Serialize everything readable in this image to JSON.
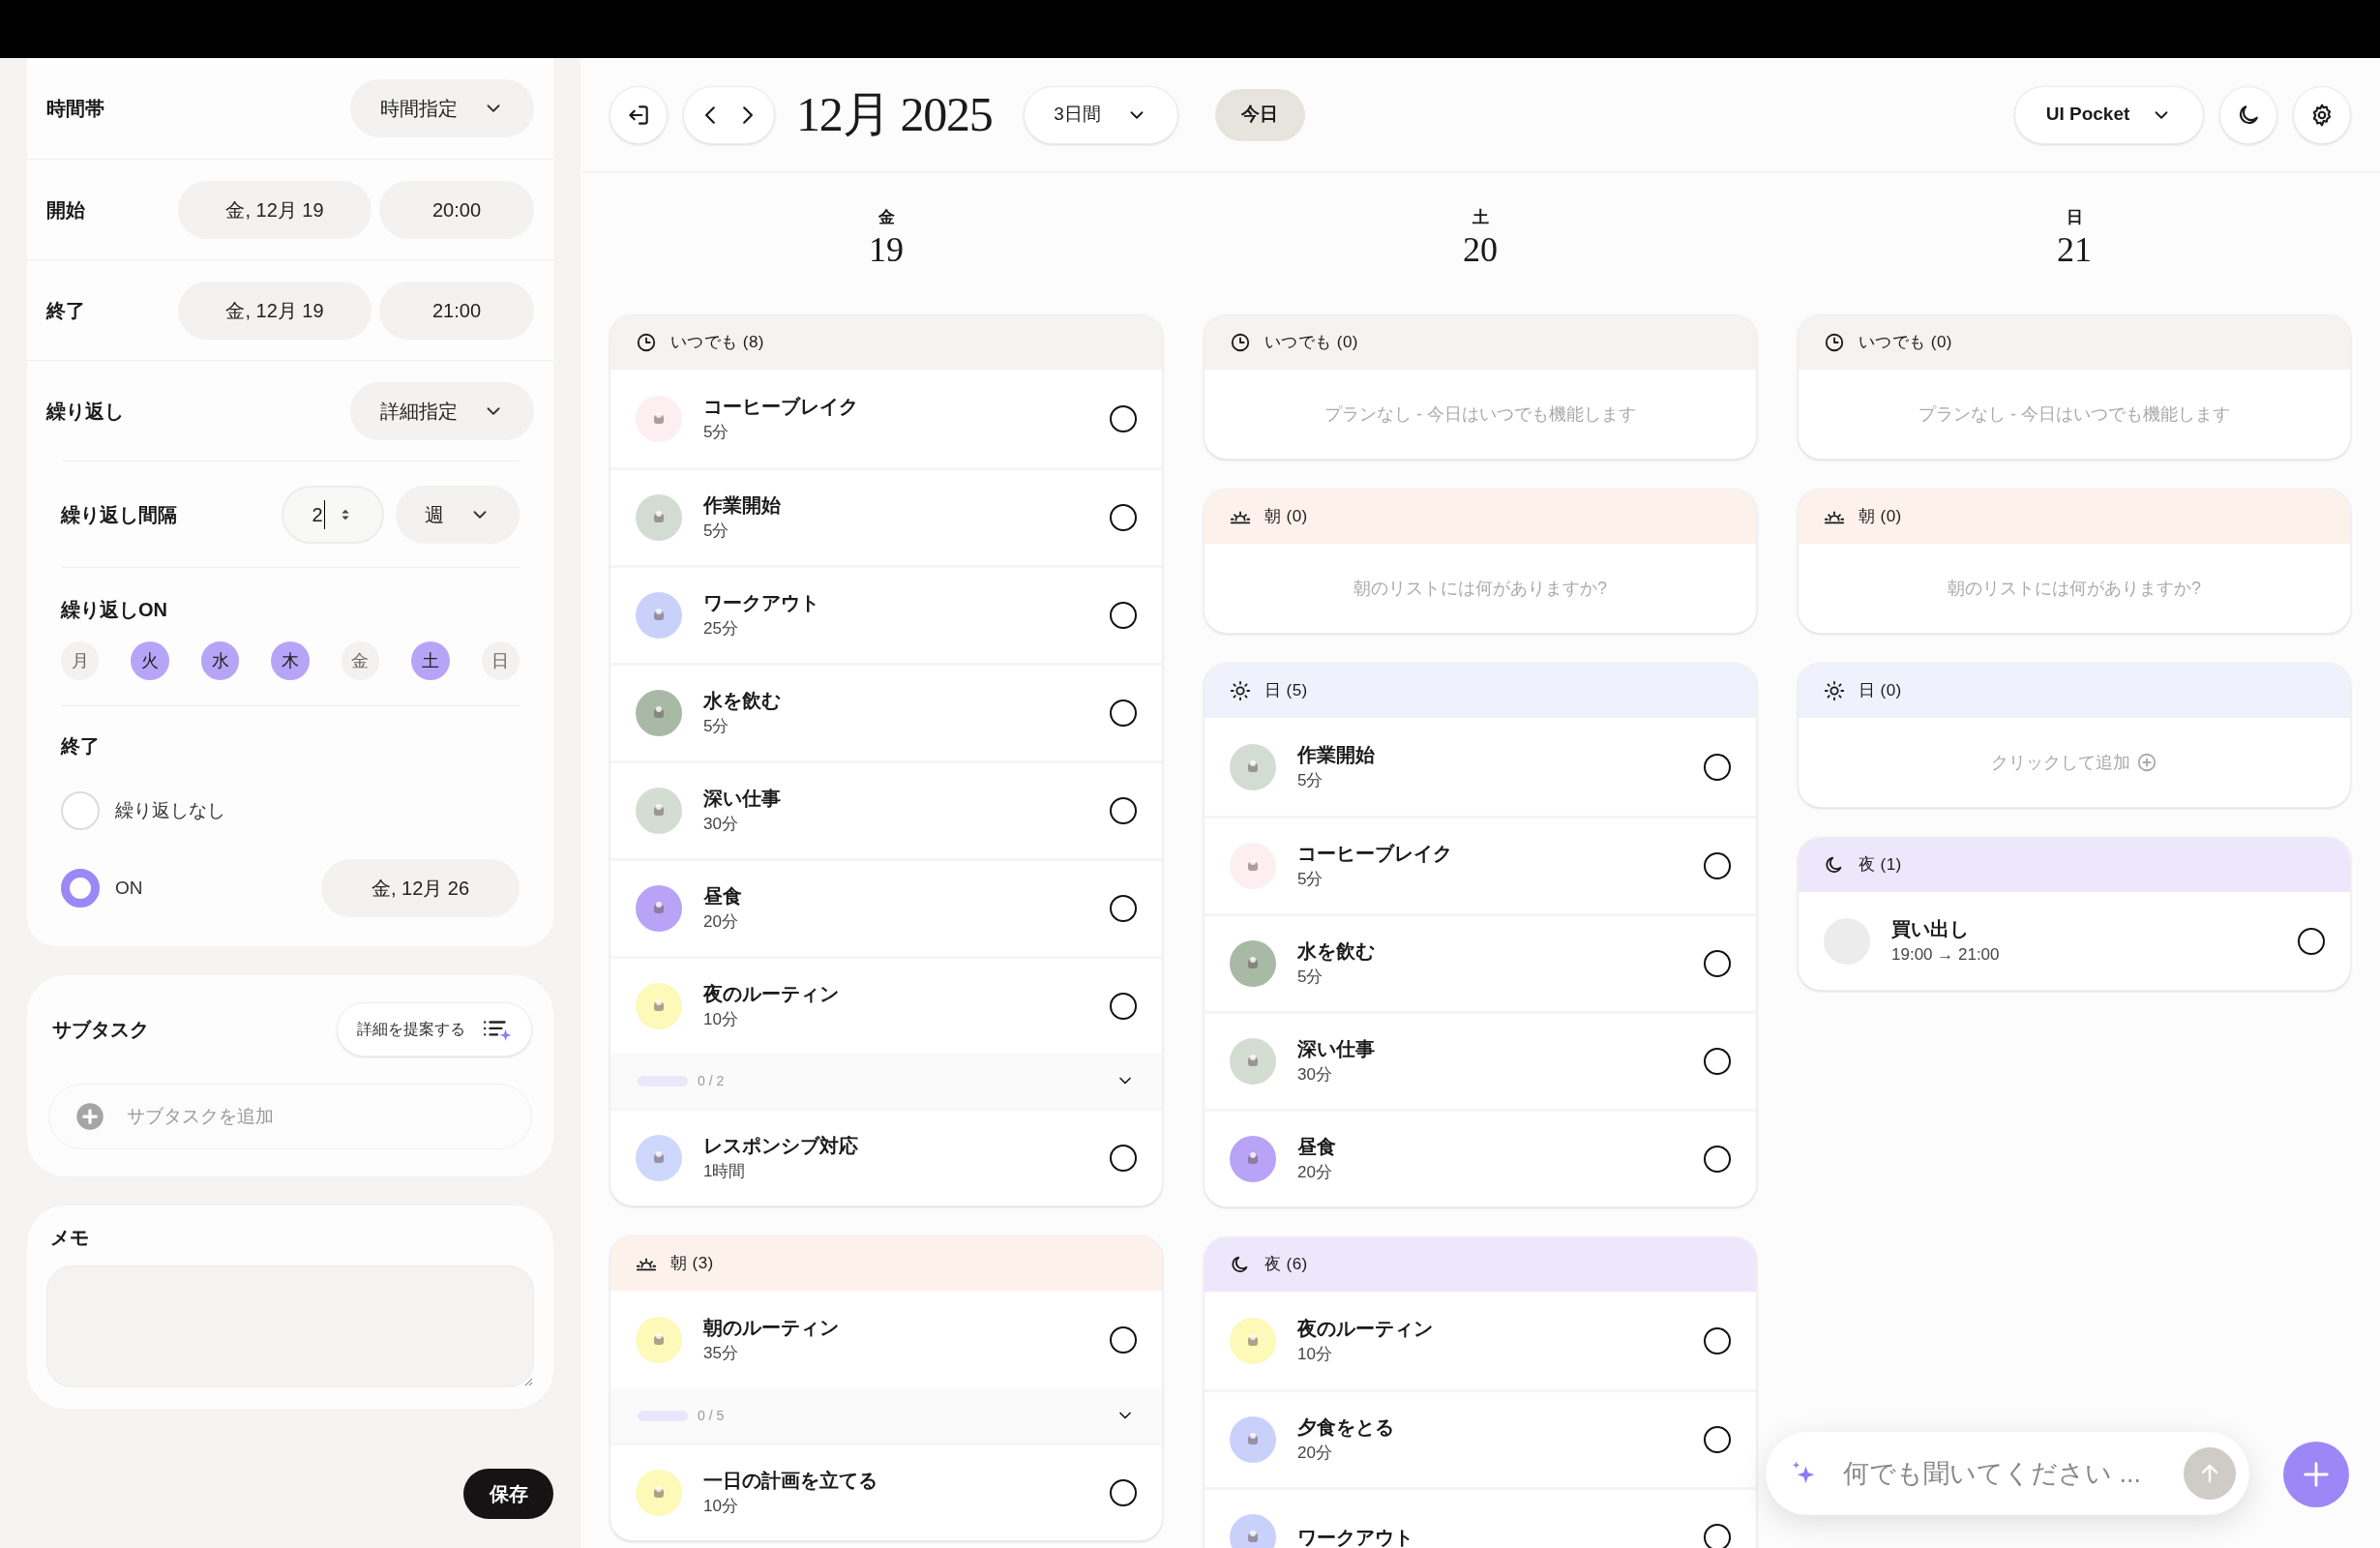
{
  "editor": {
    "rows": [
      {
        "kind": "select",
        "label": "時間帯",
        "value": "時間指定"
      },
      {
        "kind": "datetime",
        "label": "開始",
        "date": "金, 12月 19",
        "time": "20:00"
      },
      {
        "kind": "datetime",
        "label": "終了",
        "date": "金, 12月 19",
        "time": "21:00"
      },
      {
        "kind": "select",
        "label": "繰り返し",
        "value": "詳細指定"
      }
    ],
    "interval": {
      "label": "繰り返し間隔",
      "value": "2",
      "unit": "週"
    },
    "repeat_on": {
      "label": "繰り返しON",
      "days": [
        {
          "label": "月",
          "selected": false
        },
        {
          "label": "火",
          "selected": true
        },
        {
          "label": "水",
          "selected": true
        },
        {
          "label": "木",
          "selected": true
        },
        {
          "label": "金",
          "selected": false
        },
        {
          "label": "土",
          "selected": true
        },
        {
          "label": "日",
          "selected": false
        }
      ]
    },
    "end": {
      "label": "終了",
      "options": [
        {
          "label": "繰り返しなし",
          "selected": false
        },
        {
          "label": "ON",
          "selected": true,
          "date": "金, 12月 26"
        }
      ]
    },
    "subtasks": {
      "title": "サブタスク",
      "suggest_button": "詳細を提案する",
      "add_placeholder": "サブタスクを追加"
    },
    "memo": {
      "title": "メモ"
    },
    "save_button": "保存"
  },
  "header": {
    "title": "12月 2025",
    "view": "3日間",
    "today_button": "今日",
    "workspace": "UI Pocket"
  },
  "days": [
    {
      "weekday": "金",
      "date": "19",
      "sections": [
        {
          "kind": "anytime",
          "title": "いつでも",
          "count": "(8)",
          "items": [
            {
              "title": "コーヒーブレイク",
              "duration": "5分",
              "color": "#fdeef1",
              "checked": false
            },
            {
              "title": "作業開始",
              "duration": "5分",
              "color": "#d3dcd2",
              "checked": false
            },
            {
              "title": "ワークアウト",
              "duration": "25分",
              "color": "#c9d1fb",
              "checked": false
            },
            {
              "title": "水を飲む",
              "duration": "5分",
              "color": "#a8b9a5",
              "checked": false
            },
            {
              "title": "深い仕事",
              "duration": "30分",
              "color": "#d3ddd1",
              "checked": false
            },
            {
              "title": "昼食",
              "duration": "20分",
              "color": "#b8a3f6",
              "checked": false
            },
            {
              "title": "夜のルーティン",
              "duration": "10分",
              "color": "#fcf9b9",
              "checked": false,
              "subtasks": {
                "progress": "0 / 2",
                "level": 0
              }
            },
            {
              "title": "レスポンシブ対応",
              "duration": "1時間",
              "color": "#cdd7fb",
              "checked": false
            }
          ]
        },
        {
          "kind": "morning",
          "title": "朝",
          "count": "(3)",
          "items": [
            {
              "title": "朝のルーティン",
              "duration": "35分",
              "color": "#fcf9b9",
              "checked": false,
              "subtasks": {
                "progress": "0 / 5",
                "level": 0
              }
            },
            {
              "title": "一日の計画を立てる",
              "duration": "10分",
              "color": "#fcf9b9",
              "checked": false
            }
          ]
        }
      ]
    },
    {
      "weekday": "土",
      "date": "20",
      "sections": [
        {
          "kind": "anytime",
          "title": "いつでも",
          "count": "(0)",
          "empty": {
            "kind": "hint",
            "text": "プランなし - 今日はいつでも機能します"
          }
        },
        {
          "kind": "morning",
          "title": "朝",
          "count": "(0)",
          "empty": {
            "kind": "hint",
            "text": "朝のリストには何がありますか?"
          }
        },
        {
          "kind": "day",
          "title": "日",
          "count": "(5)",
          "items": [
            {
              "title": "作業開始",
              "duration": "5分",
              "color": "#d3dcd2",
              "checked": false
            },
            {
              "title": "コーヒーブレイク",
              "duration": "5分",
              "color": "#fdeef1",
              "checked": false
            },
            {
              "title": "水を飲む",
              "duration": "5分",
              "color": "#a8b9a5",
              "checked": false
            },
            {
              "title": "深い仕事",
              "duration": "30分",
              "color": "#d3ddd1",
              "checked": false
            },
            {
              "title": "昼食",
              "duration": "20分",
              "color": "#b8a3f6",
              "checked": false
            }
          ]
        },
        {
          "kind": "night",
          "title": "夜",
          "count": "(6)",
          "items": [
            {
              "title": "夜のルーティン",
              "duration": "10分",
              "color": "#fcf9b9",
              "checked": false
            },
            {
              "title": "夕食をとる",
              "duration": "20分",
              "color": "#c9d1fb",
              "checked": false
            },
            {
              "title": "ワークアウト",
              "color": "#c9d1fb",
              "checked": false
            }
          ]
        }
      ]
    },
    {
      "weekday": "日",
      "date": "21",
      "sections": [
        {
          "kind": "anytime",
          "title": "いつでも",
          "count": "(0)",
          "empty": {
            "kind": "hint",
            "text": "プランなし - 今日はいつでも機能します"
          }
        },
        {
          "kind": "morning",
          "title": "朝",
          "count": "(0)",
          "empty": {
            "kind": "hint",
            "text": "朝のリストには何がありますか?"
          }
        },
        {
          "kind": "day",
          "title": "日",
          "count": "(0)",
          "empty": {
            "kind": "add",
            "text": "クリックして追加"
          }
        },
        {
          "kind": "night",
          "title": "夜",
          "count": "(1)",
          "items": [
            {
              "title": "買い出し",
              "duration": "19:00 → 21:00",
              "color": "#ececec",
              "checked": false,
              "blank_icon": true
            }
          ]
        }
      ]
    }
  ],
  "assistant": {
    "placeholder": "何でも聞いてください ..."
  }
}
